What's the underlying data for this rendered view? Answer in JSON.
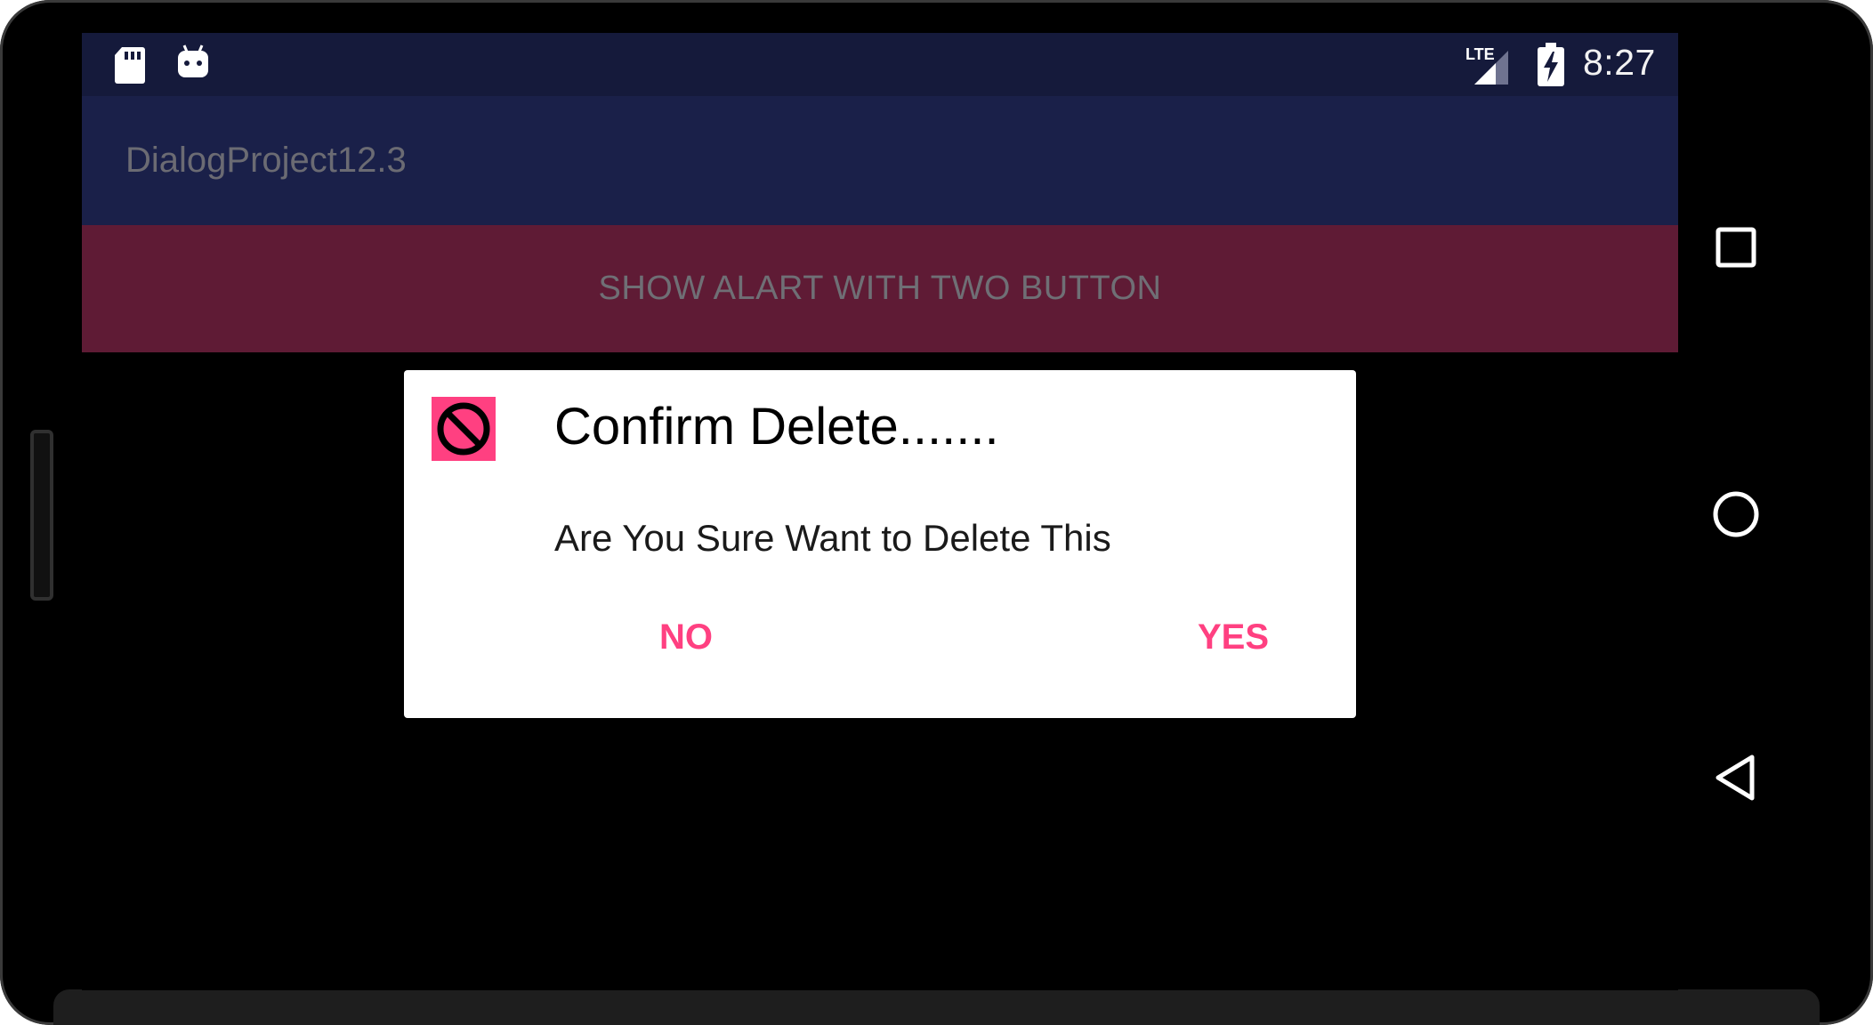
{
  "status_bar": {
    "time": "8:27",
    "network_label": "LTE",
    "icons": [
      "sd-card-icon",
      "android-debug-icon",
      "lte-signal-icon",
      "battery-charging-icon"
    ]
  },
  "app_bar": {
    "title": "DialogProject12.3"
  },
  "main": {
    "alert_button_label": "SHOW ALART WITH TWO BUTTON"
  },
  "dialog": {
    "icon": "block-icon",
    "title": "Confirm Delete.......",
    "message": "Are You Sure Want to Delete This",
    "negative_label": "NO",
    "positive_label": "YES"
  },
  "navigation_bar": {
    "icons": [
      "recents-square-icon",
      "home-circle-icon",
      "back-triangle-icon"
    ]
  },
  "colors": {
    "status_bar": "#151a3b",
    "app_bar": "#1a2049",
    "button_bg": "#5f1b35",
    "accent": "#ff4081",
    "scrim": "#000000",
    "dialog_bg": "#ffffff"
  }
}
